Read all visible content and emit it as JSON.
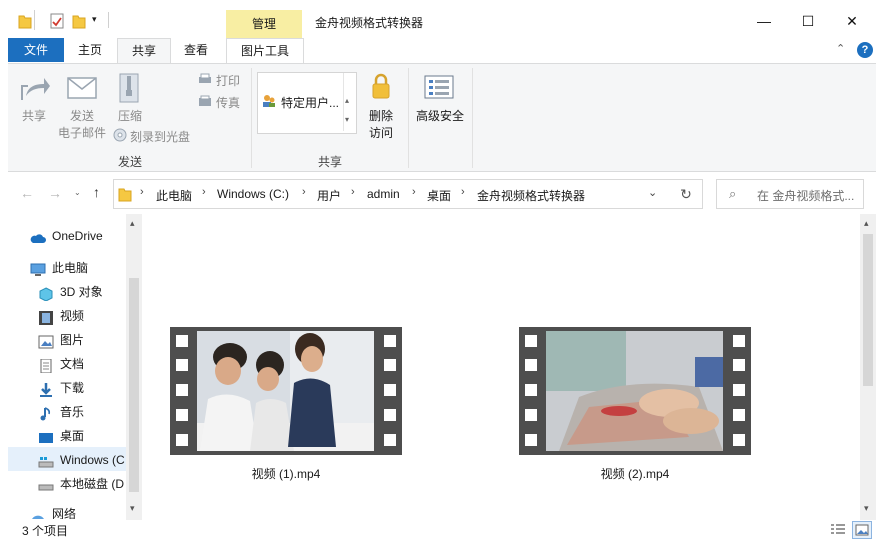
{
  "window": {
    "title": "金舟视频格式转换器",
    "context_tab": "管理",
    "controls": {
      "minimize": "—",
      "maximize": "☐",
      "close": "✕"
    }
  },
  "ribbon_tabs": {
    "file": "文件",
    "home": "主页",
    "share": "共享",
    "view": "查看",
    "picture_tools": "图片工具"
  },
  "ribbon": {
    "share_btn": "共享",
    "send_email_line1": "发送",
    "send_email_line2": "电子邮件",
    "zip": "压缩",
    "print": "打印",
    "fax": "传真",
    "burn": "刻录到光盘",
    "group_send": "发送",
    "share_with_user": "特定用户...",
    "remove_access_line1": "删除",
    "remove_access_line2": "访问",
    "advanced_security": "高级安全",
    "group_share": "共享"
  },
  "address": {
    "crumbs": [
      "此电脑",
      "Windows (C:)",
      "用户",
      "admin",
      "桌面",
      "金舟视频格式转换器"
    ],
    "search_placeholder": "在 金舟视频格式..."
  },
  "nav_pane": {
    "onedrive": "OneDrive",
    "this_pc": "此电脑",
    "items": [
      "3D 对象",
      "视频",
      "图片",
      "文档",
      "下载",
      "音乐",
      "桌面",
      "Windows (C",
      "本地磁盘 (D"
    ],
    "network": "网络"
  },
  "files": [
    {
      "name": "视频 (1).mp4"
    },
    {
      "name": "视频 (2).mp4"
    }
  ],
  "status": {
    "count": "3 个项目"
  },
  "colors": {
    "accent": "#1c6fbf",
    "manage_tab": "#f8eea3",
    "selected_nav": "#e5f0fb"
  }
}
